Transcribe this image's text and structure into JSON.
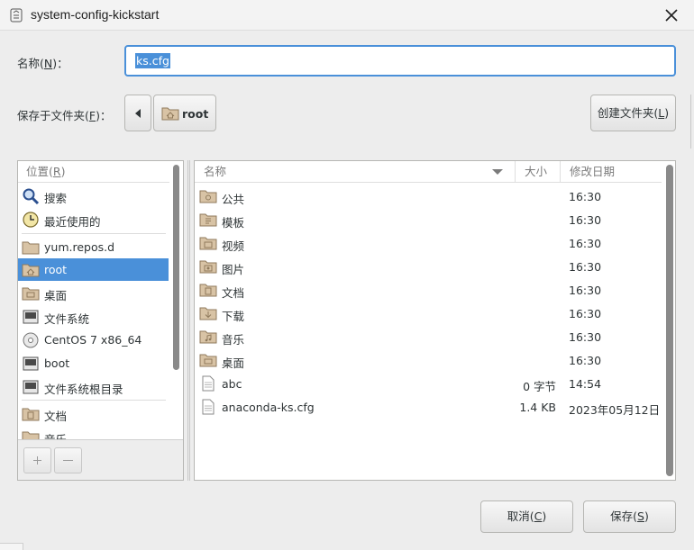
{
  "window": {
    "title": "system-config-kickstart",
    "icon": "app-icon",
    "close_icon": "close-icon"
  },
  "name_field": {
    "label_pre": "名称(",
    "mnemonic": "N",
    "label_post": ")：",
    "value": "ks.cfg"
  },
  "folder_row": {
    "label_pre": "保存于文件夹(",
    "mnemonic": "F",
    "label_post": ")：",
    "back_icon": "left-arrow-icon",
    "current": "root",
    "new_folder_pre": "创建文件夹(",
    "new_folder_mnemonic": "L",
    "new_folder_post": ")"
  },
  "places": {
    "header_pre": "位置(",
    "header_mnemonic": "R",
    "header_post": ")",
    "items": [
      {
        "label": "搜索",
        "icon": "search-icon"
      },
      {
        "label": "最近使用的",
        "icon": "recent-icon"
      },
      {
        "label": "yum.repos.d",
        "icon": "folder-icon"
      },
      {
        "label": "root",
        "icon": "home-folder-icon",
        "selected": true
      },
      {
        "label": "桌面",
        "icon": "desktop-folder-icon"
      },
      {
        "label": "文件系统",
        "icon": "drive-icon"
      },
      {
        "label": "CentOS 7 x86_64",
        "icon": "disc-icon"
      },
      {
        "label": "boot",
        "icon": "drive-icon"
      },
      {
        "label": "文件系统根目录",
        "icon": "drive-icon"
      },
      {
        "label": "文档",
        "icon": "documents-folder-icon"
      },
      {
        "label": "音乐",
        "icon": "music-folder-icon"
      }
    ],
    "add_icon": "add-bookmark-icon",
    "remove_icon": "remove-bookmark-icon"
  },
  "files": {
    "columns": {
      "name": "名称",
      "size": "大小",
      "modified": "修改日期"
    },
    "rows": [
      {
        "name": "公共",
        "size": "",
        "modified": "16:30",
        "icon": "public-folder-icon"
      },
      {
        "name": "模板",
        "size": "",
        "modified": "16:30",
        "icon": "templates-folder-icon"
      },
      {
        "name": "视频",
        "size": "",
        "modified": "16:30",
        "icon": "videos-folder-icon"
      },
      {
        "name": "图片",
        "size": "",
        "modified": "16:30",
        "icon": "pictures-folder-icon"
      },
      {
        "name": "文档",
        "size": "",
        "modified": "16:30",
        "icon": "documents-folder-icon"
      },
      {
        "name": "下载",
        "size": "",
        "modified": "16:30",
        "icon": "downloads-folder-icon"
      },
      {
        "name": "音乐",
        "size": "",
        "modified": "16:30",
        "icon": "music-folder-icon"
      },
      {
        "name": "桌面",
        "size": "",
        "modified": "16:30",
        "icon": "desktop-folder-icon"
      },
      {
        "name": "abc",
        "size": "0 字节",
        "modified": "14:54",
        "icon": "file-icon"
      },
      {
        "name": "anaconda-ks.cfg",
        "size": "1.4 KB",
        "modified": "2023年05月12日",
        "icon": "file-icon"
      }
    ]
  },
  "buttons": {
    "cancel_pre": "取消(",
    "cancel_mnemonic": "C",
    "cancel_post": ")",
    "save_pre": "保存(",
    "save_mnemonic": "S",
    "save_post": ")"
  },
  "colors": {
    "accent": "#4a90d9",
    "folder": "#d8c3a5"
  }
}
